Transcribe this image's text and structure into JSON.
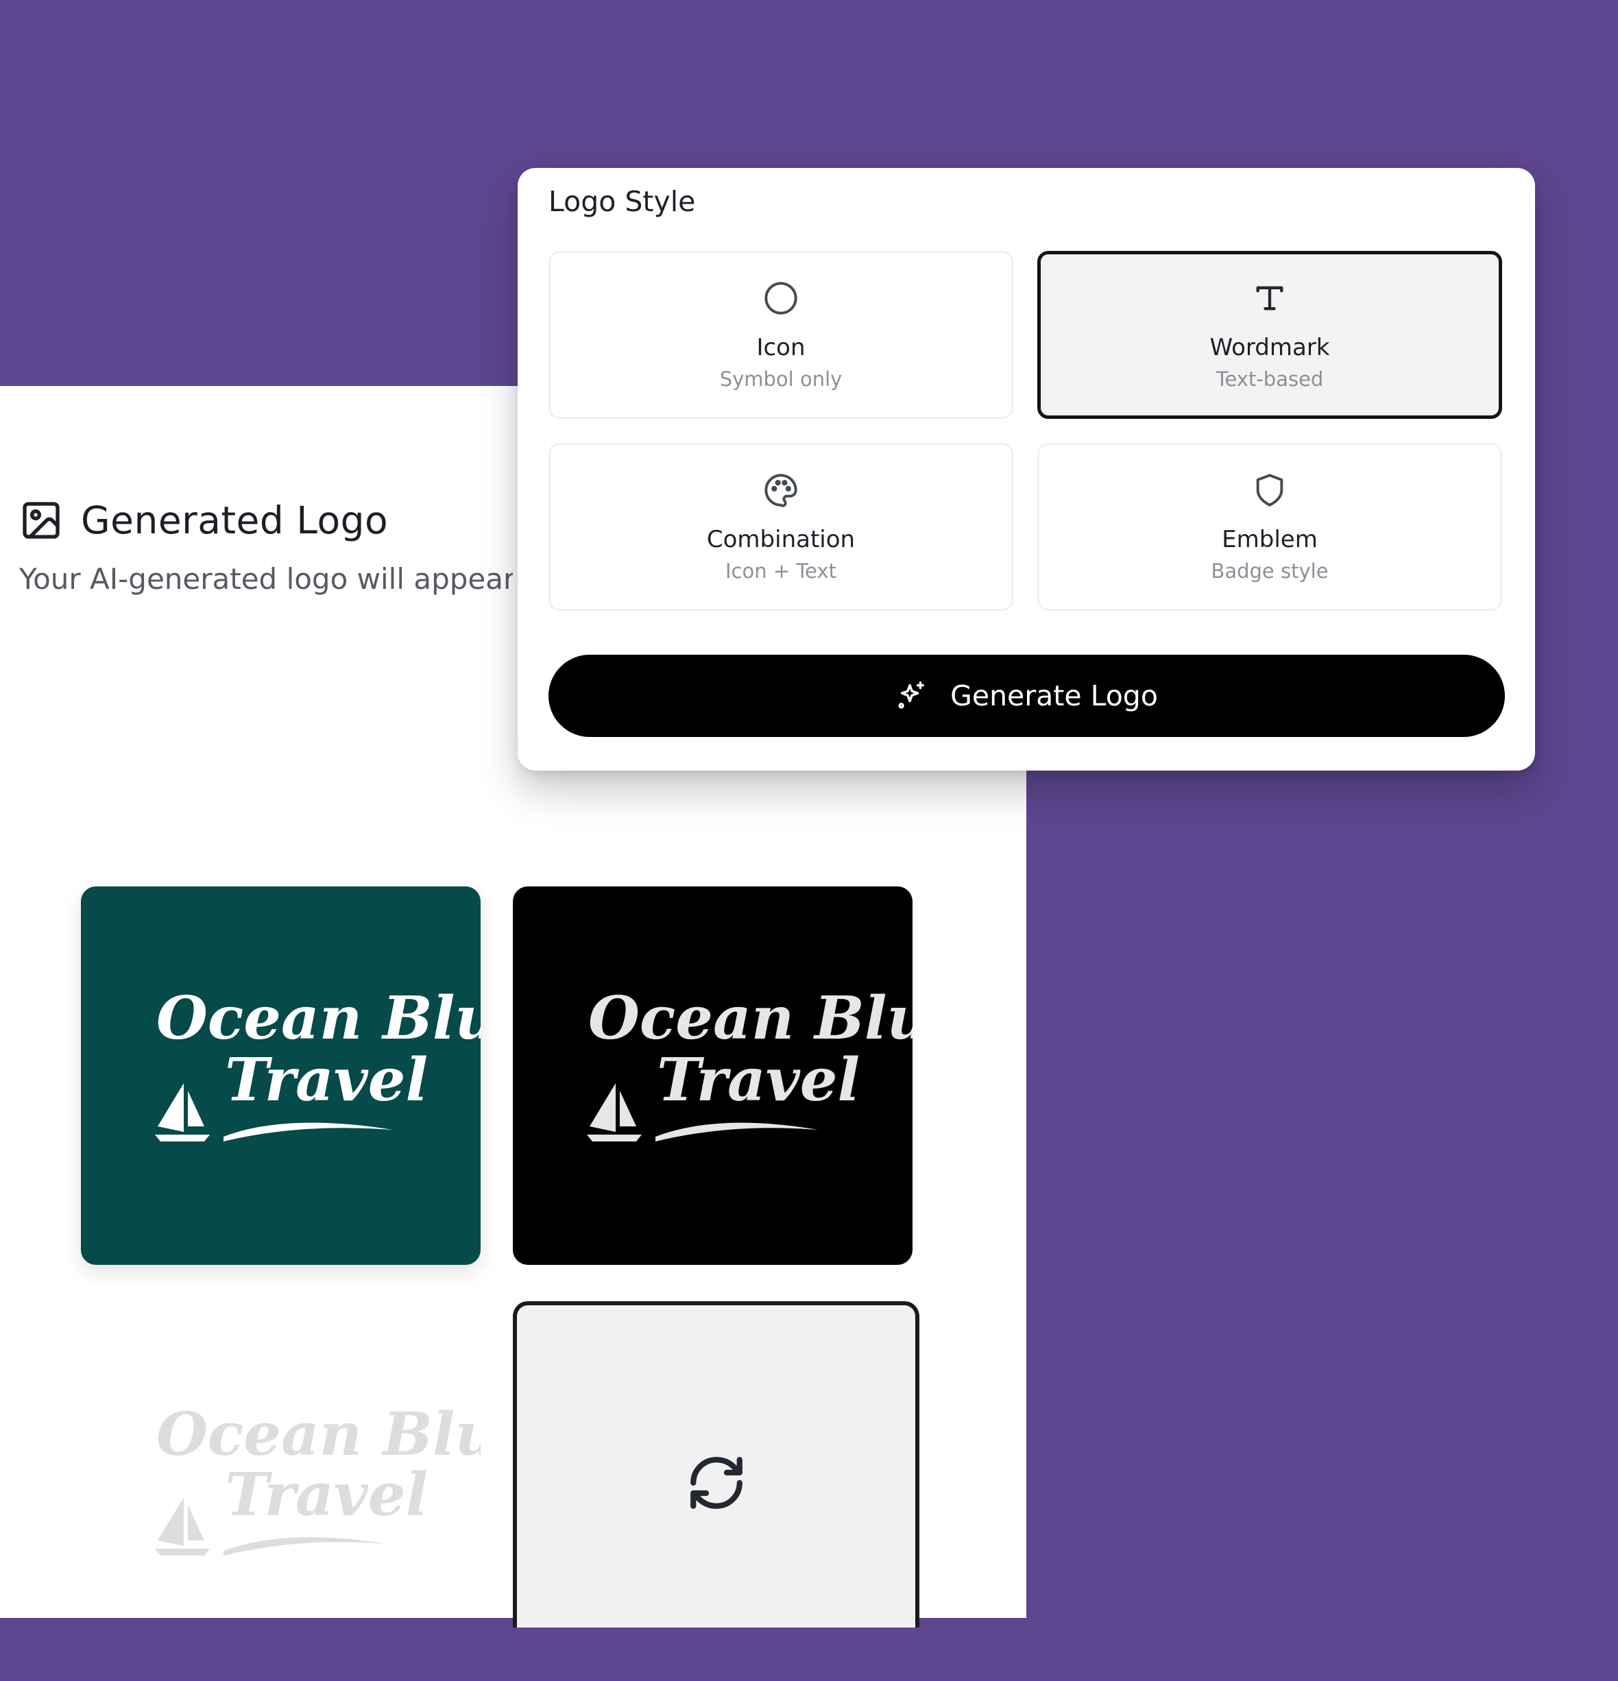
{
  "main": {
    "title": "Generated Logo",
    "subtitle": "Your AI-generated logo will appear here"
  },
  "logo_style": {
    "title": "Logo Style",
    "options": [
      {
        "label": "Icon",
        "desc": "Symbol only",
        "icon": "circle-icon",
        "selected": false
      },
      {
        "label": "Wordmark",
        "desc": "Text-based",
        "icon": "type-icon",
        "selected": true
      },
      {
        "label": "Combination",
        "desc": "Icon + Text",
        "icon": "palette-icon",
        "selected": false
      },
      {
        "label": "Emblem",
        "desc": "Badge style",
        "icon": "shield-icon",
        "selected": false
      }
    ],
    "generate_label": "Generate Logo"
  },
  "logos": {
    "line1": "Ocean Blue",
    "line2": "Travel"
  },
  "colors": {
    "background": "#5e4690",
    "teal_card": "#064a49",
    "black_card": "#000000",
    "primary_button": "#000000"
  }
}
